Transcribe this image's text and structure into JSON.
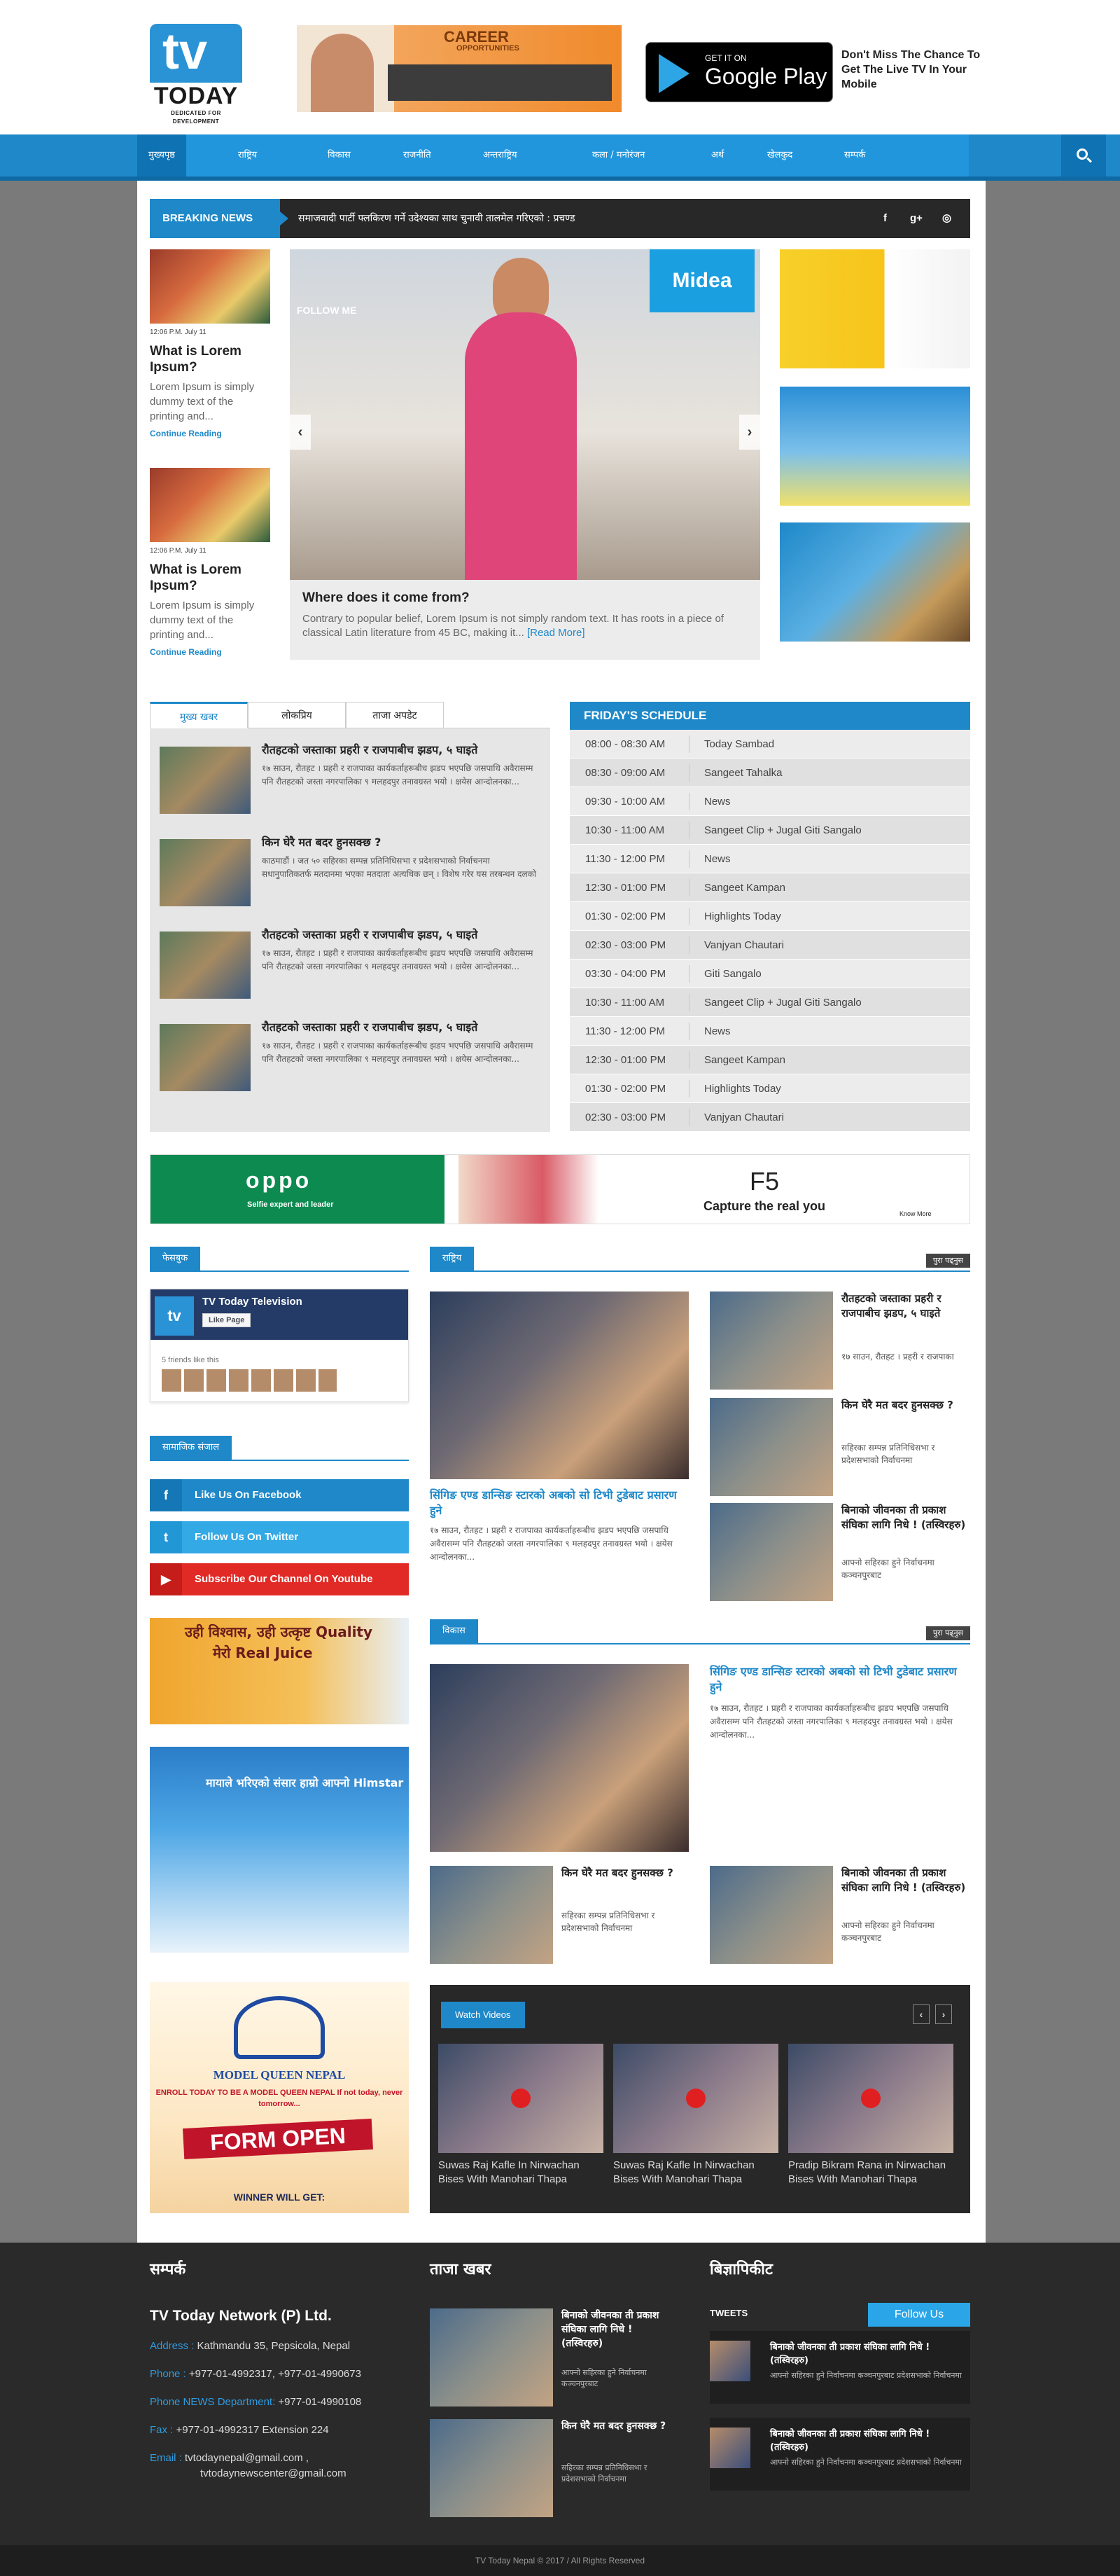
{
  "header": {
    "logo_tv": "tv",
    "logo_today": "TODAY",
    "logo_tagline": "DEDICATED FOR DEVELOPMENT",
    "career_title": "CAREER",
    "career_sub": "OPPORTUNITIES",
    "gplay_get": "GET IT ON",
    "gplay_name": "Google Play",
    "promo": "Don't Miss The Chance To Get The Live TV In Your Mobile"
  },
  "nav": {
    "items": [
      "मुख्यपृष्ठ",
      "राष्ट्रिय",
      "विकास",
      "राजनीति",
      "अन्तराष्ट्रिय",
      "कला / मनोरंजन",
      "अर्थ",
      "खेलकुद",
      "सम्पर्क"
    ]
  },
  "breaking": {
    "label": "BREAKING NEWS",
    "text": "समाजवादी पार्टी फ्लकिरण गर्ने उदेश्यका साथ चुनावी तालमेल गरिएको : प्रचण्ड",
    "social": [
      "f",
      "g+",
      "◎"
    ]
  },
  "left_cards": [
    {
      "date": "12:06 P.M. July 11",
      "title": "What is Lorem Ipsum?",
      "desc": "Lorem Ipsum is simply dummy text of the printing and...",
      "more": "Continue Reading"
    },
    {
      "date": "12:06 P.M. July 11",
      "title": "What is Lorem Ipsum?",
      "desc": "Lorem Ipsum is simply dummy text of the printing and...",
      "more": "Continue Reading"
    }
  ],
  "slider": {
    "brand": "Midea",
    "follow": "FOLLOW ME",
    "caption": "Where does it come from?",
    "desc": "Contrary to popular belief, Lorem Ipsum is not simply random text. It has roots in a piece of classical Latin literature from 45 BC, making it...",
    "read_more": "[Read More]"
  },
  "tabs": {
    "labels": [
      "मुख्य खबर",
      "लोकप्रिय",
      "ताजा अपडेट"
    ],
    "rows": [
      {
        "title": "रौतहटको जस्ताका प्रहरी र राजपाबीच झडप, ५ घाइते",
        "desc": "१७ साउन, रौतहट । प्रहरी र राजपाका कार्यकर्ताहरूबीच झडप भएपछि जसपाधि अवैरासम्म पनि रौतहटको जस्ता नगरपालिका ९ मलहदपुर तनावग्रस्त भयो । क्षयेस आन्दोलनका..."
      },
      {
        "title": "किन घेरै मत बदर हुनसक्छ ?",
        "desc": "काठमाडौं । जत ५० सहिरका सम्पन्न प्रतिनिधिसभा र प्रदेशसभाको निर्वाचनमा सधानुपातिकतर्फ मतदानमा भएका मतदाता अत्यधिक छन् । विशेष गरेर यस तरबन्धन दलको"
      },
      {
        "title": "रौतहटको जस्ताका प्रहरी र राजपाबीच झडप, ५ घाइते",
        "desc": "१७ साउन, रौतहट । प्रहरी र राजपाका कार्यकर्ताहरूबीच झडप भएपछि जसपाधि अवैरासम्म पनि रौतहटको जस्ता नगरपालिका ९ मलहदपुर तनावग्रस्त भयो । क्षयेस आन्दोलनका..."
      },
      {
        "title": "रौतहटको जस्ताका प्रहरी र राजपाबीच झडप, ५ घाइते",
        "desc": "१७ साउन, रौतहट । प्रहरी र राजपाका कार्यकर्ताहरूबीच झडप भएपछि जसपाधि अवैरासम्म पनि रौतहटको जस्ता नगरपालिका ९ मलहदपुर तनावग्रस्त भयो । क्षयेस आन्दोलनका..."
      }
    ]
  },
  "schedule": {
    "title": "FRIDAY'S SCHEDULE",
    "rows": [
      {
        "time": "08:00 - 08:30 AM",
        "show": "Today Sambad"
      },
      {
        "time": "08:30 - 09:00 AM",
        "show": "Sangeet Tahalka"
      },
      {
        "time": "09:30 - 10:00 AM",
        "show": "News"
      },
      {
        "time": "10:30 - 11:00 AM",
        "show": "Sangeet Clip + Jugal Giti Sangalo"
      },
      {
        "time": "11:30 - 12:00 PM",
        "show": "News"
      },
      {
        "time": "12:30 - 01:00 PM",
        "show": "Sangeet Kampan"
      },
      {
        "time": "01:30 - 02:00 PM",
        "show": "Highlights Today"
      },
      {
        "time": "02:30 - 03:00 PM",
        "show": "Vanjyan Chautari"
      },
      {
        "time": "03:30 - 04:00 PM",
        "show": "Giti Sangalo"
      },
      {
        "time": "10:30 - 11:00 AM",
        "show": "Sangeet Clip + Jugal Giti Sangalo"
      },
      {
        "time": "11:30 - 12:00 PM",
        "show": "News"
      },
      {
        "time": "12:30 - 01:00 PM",
        "show": "Sangeet Kampan"
      },
      {
        "time": "01:30 - 02:00 PM",
        "show": "Highlights Today"
      },
      {
        "time": "02:30 - 03:00 PM",
        "show": "Vanjyan Chautari"
      }
    ]
  },
  "oppo": {
    "brand": "oppo",
    "slogan": "Selfie expert and leader",
    "model": "F5",
    "caption": "Capture the real you",
    "know_more": "Know More"
  },
  "facebook": {
    "label": "फेसबुक",
    "page": "TV Today Television",
    "like": "Like Page",
    "friends": "5 friends like this",
    "avatar": "tv"
  },
  "social_section": {
    "label": "सामाजिक संजाल",
    "buttons": [
      {
        "icon": "f",
        "text": "Like Us On Facebook",
        "color": "#1e88c9"
      },
      {
        "icon": "t",
        "text": "Follow Us On Twitter",
        "color": "#33a9e6"
      },
      {
        "icon": "▶",
        "text": "Subscribe Our Channel On Youtube",
        "color": "#e12a26"
      }
    ]
  },
  "ads": {
    "juice_1": "उही विश्वास, उही उत्कृष्ट Quality",
    "juice_2": "मेरो Real Juice",
    "himstar": "मायाले भरिएको संसार हाम्रो आफ्नो Himstar",
    "mq_title": "MODEL QUEEN NEPAL",
    "mq_enroll": "ENROLL TODAY TO BE A MODEL QUEEN NEPAL If not today, never tomorrow...",
    "mq_form": "FORM OPEN",
    "mq_winner": "WINNER WILL GET:"
  },
  "rashtriya": {
    "label": "राष्ट्रिय",
    "more": "पुरा पढ्नुस",
    "main_title": "सिंगिङ एण्ड डान्सिङ स्टारको अबको सो टिभी टुडेबाट प्रसारण हुने",
    "main_desc": "१७ साउन, रौतहट । प्रहरी र राजपाका कार्यकर्ताहरूबीच झडप भएपछि जसपाधि अवैरासम्म पनि रौतहटको जस्ता नगरपालिका ९ मलहदपुर तनावग्रस्त भयो । क्षयेस आन्दोलनका...",
    "side": [
      {
        "title": "रौतहटको जस्ताका प्रहरी र राजपाबीच झडप, ५ घाइते",
        "desc": "१७ साउन, रौतहट । प्रहरी र राजपाका"
      },
      {
        "title": "किन घेरै मत बदर हुनसक्छ ?",
        "desc": "सहिरका सम्पन्न प्रतिनिधिसभा र प्रदेशसभाको निर्वाचनमा"
      },
      {
        "title": "बिनाको जीवनका ती प्रकाश संघिका लागि निधे ! (तस्विरहरु)",
        "desc": "आफ्नो सहिरका हुने निर्वाचनमा कञ्चनपुरबाट"
      }
    ]
  },
  "bikas": {
    "label": "विकास",
    "more": "पुरा पढ्नुस",
    "main_title": "सिंगिङ एण्ड डान्सिङ स्टारको अबको सो टिभी टुडेबाट प्रसारण हुने",
    "main_desc": "१७ साउन, रौतहट । प्रहरी र राजपाका कार्यकर्ताहरूबीच झडप भएपछि जसपाधि अवैरासम्म पनि रौतहटको जस्ता नगरपालिका ९ मलहदपुर तनावग्रस्त भयो । क्षयेस आन्दोलनका...",
    "bottom": [
      {
        "title": "किन घेरै मत बदर हुनसक्छ ?",
        "desc": "सहिरका सम्पन्न प्रतिनिधिसभा र प्रदेशसभाको निर्वाचनमा"
      },
      {
        "title": "बिनाको जीवनका ती प्रकाश संघिका लागि निधे ! (तस्विरहरु)",
        "desc": "आफ्नो सहिरका हुने निर्वाचनमा कञ्चनपुरबाट"
      }
    ]
  },
  "videos": {
    "label": "Watch Videos",
    "prev": "‹",
    "next": "›",
    "items": [
      {
        "title": "Suwas Raj Kafle In Nirwachan Bises With Manohari Thapa"
      },
      {
        "title": "Suwas Raj Kafle In Nirwachan Bises With Manohari Thapa"
      },
      {
        "title": "Pradip Bikram Rana in Nirwachan Bises With Manohari Thapa"
      }
    ]
  },
  "footer": {
    "contact_head": "सम्पर्क",
    "news_head": "ताजा खबर",
    "tweets_head": "बिज्ञापिकीट",
    "tweets_label": "TWEETS",
    "follow_btn": "Follow Us",
    "company": "TV Today Network (P) Ltd.",
    "rows": [
      {
        "k": "Address :",
        "v": "Kathmandu 35, Pepsicola, Nepal"
      },
      {
        "k": "Phone :",
        "v": "+977-01-4992317, +977-01-4990673"
      },
      {
        "k": "Phone NEWS Department:",
        "v": "+977-01-4990108"
      },
      {
        "k": "Fax :",
        "v": "+977-01-4992317 Extension 224"
      },
      {
        "k": "Email :",
        "v": "tvtodaynepal@gmail.com ,"
      },
      {
        "k": "",
        "v": "tvtodaynewscenter@gmail.com"
      }
    ],
    "news": [
      {
        "title": "बिनाको जीवनका ती प्रकाश संघिका लागि निधे ! (तस्विरहरु)",
        "desc": "आफ्नो सहिरका हुने निर्वाचनमा कञ्चनपुरबाट"
      },
      {
        "title": "किन घेरै मत बदर हुनसक्छ ?",
        "desc": "सहिरका सम्पन्न प्रतिनिधिसभा र प्रदेशसभाको निर्वाचनमा"
      }
    ],
    "tweets": [
      {
        "title": "बिनाको जीवनका ती प्रकाश संघिका लागि निधे ! (तस्विरहरु)",
        "desc": "आफ्नो सहिरका हुने निर्वाचनमा कञ्चनपुरबाट प्रदेशसभाको निर्वाचनमा"
      },
      {
        "title": "बिनाको जीवनका ती प्रकाश संघिका लागि निधे ! (तस्विरहरु)",
        "desc": "आफ्नो सहिरका हुने निर्वाचनमा कञ्चनपुरबाट प्रदेशसभाको निर्वाचनमा"
      }
    ],
    "copyright": "TV Today Nepal © 2017 / All Rights Reserved"
  }
}
